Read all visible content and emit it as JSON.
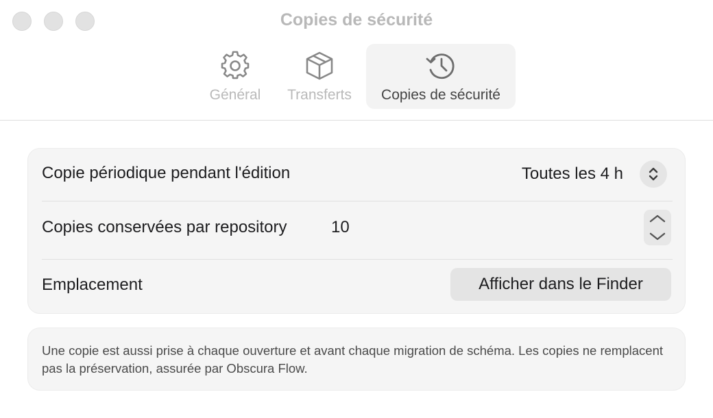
{
  "window": {
    "title": "Copies de sécurité",
    "controls": [
      "close",
      "minimize",
      "zoom"
    ]
  },
  "toolbar": {
    "tabs": [
      {
        "label": "Général",
        "icon": "gear-icon",
        "selected": false
      },
      {
        "label": "Transferts",
        "icon": "box-icon",
        "selected": false
      },
      {
        "label": "Copies de sécurité",
        "icon": "clock-history-icon",
        "selected": true
      }
    ]
  },
  "settings": {
    "periodic": {
      "label": "Copie périodique pendant l'édition",
      "value": "Toutes les 4 h"
    },
    "retention": {
      "label": "Copies conservées par repository",
      "value": "10"
    },
    "location": {
      "label": "Emplacement",
      "button_label": "Afficher dans le Finder"
    }
  },
  "note": {
    "text": "Une copie est aussi prise à chaque ouverture et avant chaque migration de schéma. Les copies ne remplacent pas la préservation, assurée par Obscura Flow."
  },
  "colors": {
    "selected_tab_bg": "#f3f3f3",
    "card_bg": "#f5f5f5",
    "inactive_text": "#b9b9b9"
  }
}
